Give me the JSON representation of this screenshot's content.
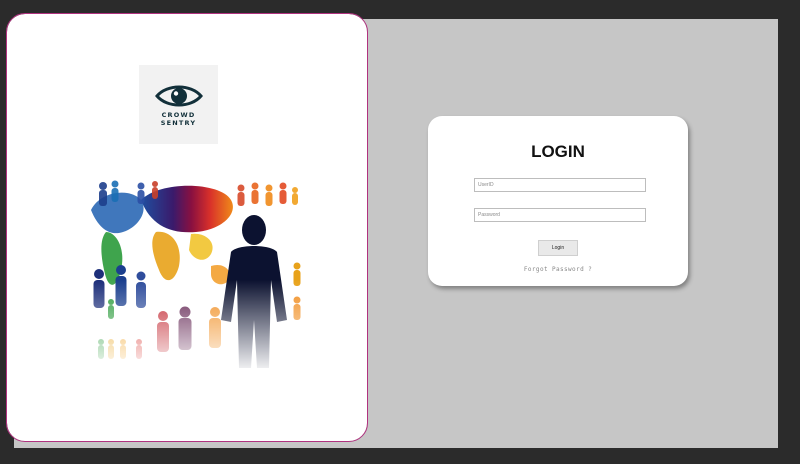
{
  "logo": {
    "line1": "CROWD",
    "line2": "SENTRY",
    "icon": "eye-icon"
  },
  "login": {
    "title": "LOGIN",
    "userid_placeholder": "UserID",
    "password_placeholder": "Password",
    "button_label": "Login",
    "forgot_label": "Forgot Password ?"
  },
  "colors": {
    "page_background": "#c6c6c6",
    "window_frame": "#2b2b2b",
    "card": "#ffffff",
    "brand_dark": "#12303a",
    "selection_outline": "#b0327f"
  }
}
